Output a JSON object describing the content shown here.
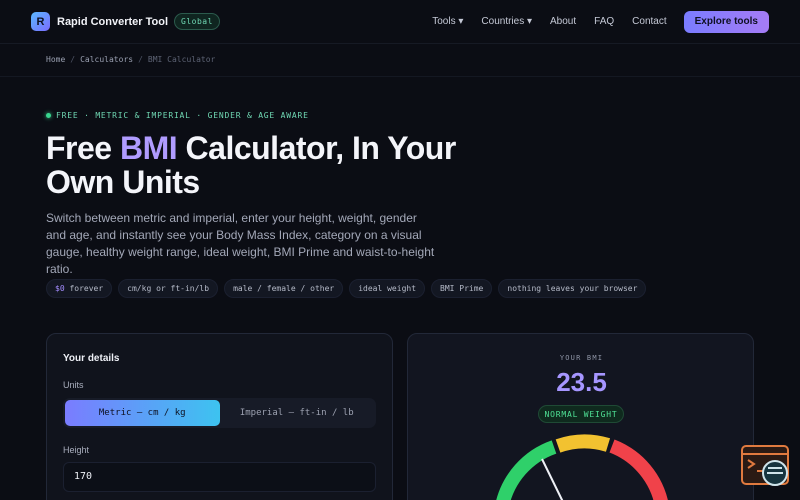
{
  "nav": {
    "logo_letter": "R",
    "brand": "Rapid Converter Tool",
    "badge": "Global",
    "links": [
      "Tools ▾",
      "Countries ▾",
      "About",
      "FAQ",
      "Contact"
    ],
    "cta": "Explore tools"
  },
  "breadcrumb": {
    "home": "Home",
    "sep": "/",
    "calculators": "Calculators",
    "current": "BMI Calculator"
  },
  "hero": {
    "tagline": "FREE · METRIC & IMPERIAL · GENDER & AGE AWARE",
    "title_before": "Free ",
    "title_accent": "BMI",
    "title_after": " Calculator, In Your Own Units",
    "description": "Switch between metric and imperial, enter your height, weight, gender and age, and instantly see your Body Mass Index, category on a visual gauge, healthy weight range, ideal weight, BMI Prime and waist-to-height ratio.",
    "chip_free": "$0",
    "chip_free_rest": " forever",
    "chips": [
      "cm/kg or ft-in/lb",
      "male / female / other",
      "ideal weight",
      "BMI Prime",
      "nothing leaves your browser"
    ]
  },
  "details": {
    "title": "Your details",
    "units_label": "Units",
    "unit_metric": "Metric — cm / kg",
    "unit_imperial": "Imperial — ft-in / lb",
    "height_label": "Height",
    "height_value": "170"
  },
  "result": {
    "label": "YOUR BMI",
    "value": "23.5",
    "category": "NORMAL WEIGHT"
  },
  "colors": {
    "accent": "#a696ff",
    "normal": "#4fe095",
    "gauge_green": "#2fd06a",
    "gauge_yellow": "#f2c230",
    "gauge_red": "#f0424a"
  }
}
